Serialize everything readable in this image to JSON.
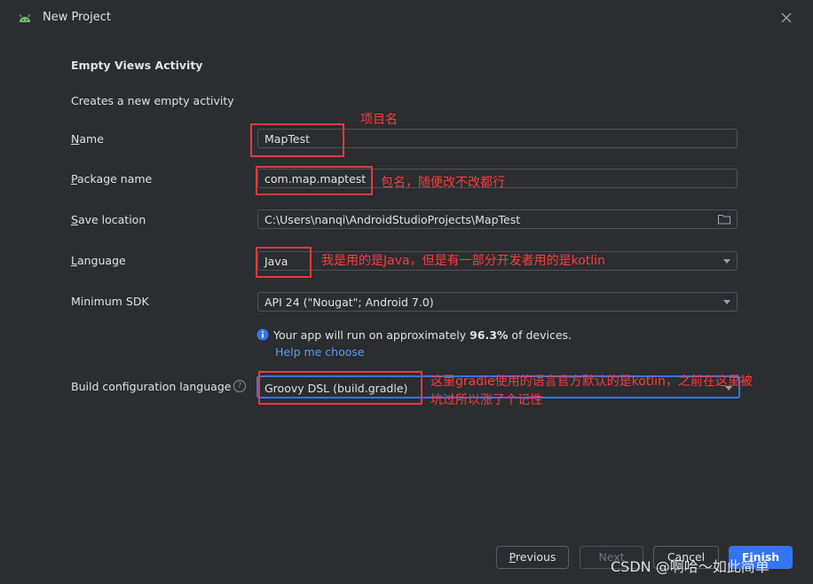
{
  "window": {
    "title": "New Project"
  },
  "section": {
    "title": "Empty Views Activity",
    "description": "Creates a new empty activity"
  },
  "form": {
    "name": {
      "label_u": "N",
      "label_rest": "ame",
      "value": "MapTest"
    },
    "package": {
      "label_u": "P",
      "label_rest": "ackage name",
      "value": "com.map.maptest"
    },
    "save_location": {
      "label_u": "S",
      "label_rest": "ave location",
      "value": "C:\\Users\\nanqi\\AndroidStudioProjects\\MapTest"
    },
    "language": {
      "label_u": "L",
      "label_rest": "anguage",
      "value": "Java"
    },
    "min_sdk": {
      "label": "Minimum SDK",
      "value": "API 24 (\"Nougat\"; Android 7.0)"
    },
    "build_config": {
      "label": "Build configuration language",
      "value": "Groovy DSL (build.gradle)"
    }
  },
  "info": {
    "prefix": "Your app will run on approximately ",
    "percent": "96.3%",
    "suffix": " of devices.",
    "help_link": "Help me choose"
  },
  "annotations": {
    "name": "项目名",
    "package": "包名，随便改不改都行",
    "language": "我是用的是Java，但是有一部分开发者用的是kotlin",
    "build_line1": "这里gradle使用的语言官方默认的是kotlin，之前在这里被",
    "build_line2": "坑过所以涨了个记性"
  },
  "buttons": {
    "previous_u": "P",
    "previous_rest": "revious",
    "next": "Next",
    "cancel": "Cancel",
    "finish": "Finish"
  },
  "watermark": "CSDN @啊哈～如此简单",
  "colors": {
    "accent": "#3574f0",
    "annotation": "#e8383d",
    "link": "#589df6",
    "background": "#2b2d30"
  }
}
